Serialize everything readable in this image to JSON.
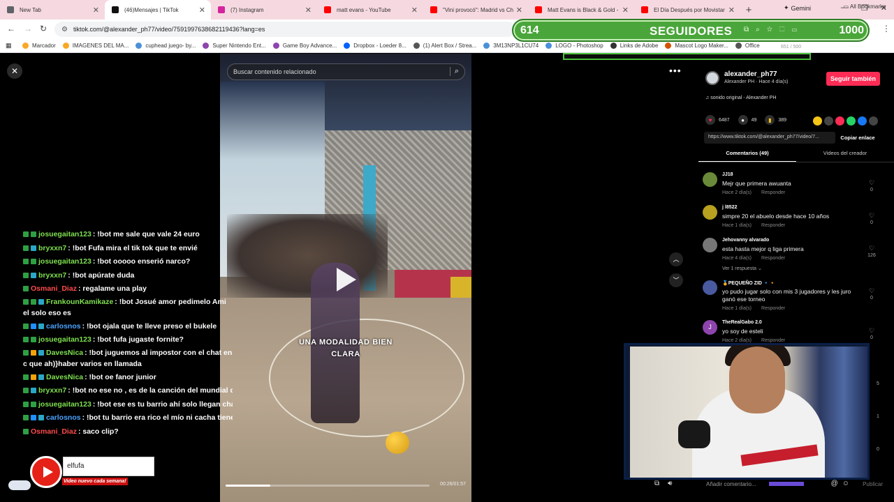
{
  "browser": {
    "tabs": [
      {
        "title": "New Tab",
        "color": "#5f6368"
      },
      {
        "title": "(46)Mensajes | TikTok",
        "color": "#111111"
      },
      {
        "title": "(7) Instagram",
        "color": "#d6249f"
      },
      {
        "title": "matt evans - YouTube",
        "color": "#ff0000"
      },
      {
        "title": "\"Vini provocó\": Madrid vs Ch",
        "color": "#ff0000"
      },
      {
        "title": "Matt Evans is Black & Gold -",
        "color": "#ff0000"
      },
      {
        "title": "El Día Después por Movistar",
        "color": "#ff0000"
      }
    ],
    "active_tab_index": 1,
    "new_tab": "+",
    "gemini_label": "Gemini",
    "url": "tiktok.com/@alexander_ph77/video/7591997638682119436?lang=es",
    "bookmarks": [
      {
        "label": "Marcador",
        "color": "#f9a825"
      },
      {
        "label": "IMAGENES DEL MA...",
        "color": "#f9a825"
      },
      {
        "label": "cuphead juego- by...",
        "color": "#4a90d9"
      },
      {
        "label": "Super Nintendo Ent...",
        "color": "#8e44ad"
      },
      {
        "label": "Game Boy Advance...",
        "color": "#8e44ad"
      },
      {
        "label": "Dropbox - Loeder 8...",
        "color": "#0061fe"
      },
      {
        "label": "(1) Alert Box / Strea...",
        "color": "#555555"
      },
      {
        "label": "3M13NP3L1CU74",
        "color": "#4a90d9"
      },
      {
        "label": "LOGO - Photoshop",
        "color": "#4a90d9"
      },
      {
        "label": "Links de Adobe",
        "color": "#333333"
      },
      {
        "label": "Mascot Logo Maker...",
        "color": "#d35400"
      },
      {
        "label": "Office",
        "color": "#555555"
      }
    ],
    "all_bookmarks": "All Bookmarks"
  },
  "followers": {
    "count": "614",
    "label": "SEGUIDORES",
    "goal": "1000",
    "small_text": "651 / 500",
    "progress": 0.614
  },
  "video": {
    "search_placeholder": "Buscar contenido relacionado",
    "caption": "UNA MODALIDAD BIEN CLARA",
    "time": "00:26/01:57",
    "progress": 0.22
  },
  "chat": [
    {
      "user": "josuegaitan123",
      "color": "#7ee04f",
      "badges": [
        "#2ea043",
        "#2ea043"
      ],
      "text": ": !bot me sale que vale 24 euro"
    },
    {
      "user": "bryxxn7",
      "color": "#7ee04f",
      "badges": [
        "#2ea043",
        "#2aa7c7"
      ],
      "text": ": !bot Fufa mira el tik tok que te envié"
    },
    {
      "user": "josuegaitan123",
      "color": "#7ee04f",
      "badges": [
        "#2ea043",
        "#2ea043"
      ],
      "text": ": !bot ooooo enserió narco?"
    },
    {
      "user": "bryxxn7",
      "color": "#7ee04f",
      "badges": [
        "#2ea043",
        "#2aa7c7"
      ],
      "text": ": !bot apúrate duda"
    },
    {
      "user": "Osmani_Diaz",
      "color": "#ff4b4b",
      "badges": [
        "#2ea043"
      ],
      "text": ": regalame una play"
    },
    {
      "user": "FrankounKamikaze",
      "color": "#7ee04f",
      "badges": [
        "#2ea043",
        "#2ea043",
        "#2aa7c7"
      ],
      "text": ": !bot Josué amor pedimelo Ami el solo eso es",
      "wrap": true
    },
    {
      "user": "carlosnos",
      "color": "#4aa3ff",
      "badges": [
        "#2ea043",
        "#1e90ff",
        "#2aa7c7"
      ],
      "text": ": !bot ojala que te lleve preso el bukele"
    },
    {
      "user": "josuegaitan123",
      "color": "#7ee04f",
      "badges": [
        "#2ea043",
        "#2ea043"
      ],
      "text": ": !bot fufa jugaste fornite?"
    },
    {
      "user": "DavesNica",
      "color": "#7ee04f",
      "badges": [
        "#2ea043",
        "#f0a30a",
        "#2aa7c7"
      ],
      "text": ": !bot juguemos al impostor con el chat en c que ah)}haber varios en llamada",
      "wrap": true
    },
    {
      "user": "DavesNica",
      "color": "#7ee04f",
      "badges": [
        "#2ea043",
        "#f0a30a",
        "#2aa7c7"
      ],
      "text": ": !bot oe fanor junior"
    },
    {
      "user": "bryxxn7",
      "color": "#7ee04f",
      "badges": [
        "#2ea043",
        "#2aa7c7"
      ],
      "text": ": !bot no ese no , es de la canción del mundial de"
    },
    {
      "user": "josuegaitan123",
      "color": "#7ee04f",
      "badges": [
        "#2ea043",
        "#2ea043"
      ],
      "text": ": !bot ese es tu barrio ahí solo llegan cha"
    },
    {
      "user": "carlosnos",
      "color": "#4aa3ff",
      "badges": [
        "#2ea043",
        "#1e90ff",
        "#2aa7c7"
      ],
      "text": ": !bot tu barrio era rico el mío ni cacha tiene"
    },
    {
      "user": "Osmani_Diaz",
      "color": "#ff4b4b",
      "badges": [
        "#2ea043"
      ],
      "text": ": saco clip?"
    }
  ],
  "stream_overlay": {
    "input_value": "elfufa",
    "subtitle": "Video nuevo cada semana!"
  },
  "creator": {
    "username": "alexander_ph77",
    "subline": "Alexander PH · Hace 4 día(s)",
    "follow_label": "Seguir también",
    "sound": "sonido original - Alexander PH",
    "likes": "6487",
    "comments": "49",
    "saves": "389",
    "link": "https://www.tiktok.com/@alexander_ph77/video/7...",
    "copy_label": "Copiar enlace",
    "share_colors": [
      "#f5c518",
      "#444444",
      "#fe2c55",
      "#25d366",
      "#1877f2",
      "#444444"
    ]
  },
  "tabs": {
    "comments": "Comentarios (49)",
    "creator_videos": "Videos del creador"
  },
  "comments": [
    {
      "user": "JJ18",
      "text": "Mejr que primera awuanta",
      "time": "Hace 2 día(s)",
      "reply": "Responder",
      "likes": "0",
      "avatar": "#6a8a3a"
    },
    {
      "user": "j l8522",
      "text": "simpre 20 el abuelo desde hace 10 años",
      "time": "Hace 1 día(s)",
      "reply": "Responder",
      "likes": "0",
      "avatar": "#b8a020"
    },
    {
      "user": "Jehovanny alvarado",
      "text": "esta hasta mejor q liga primera",
      "time": "Hace 4 día(s)",
      "reply": "Responder",
      "likes": "126",
      "avatar": "#777777",
      "replies": "Ver 1 respuesta ⌄"
    },
    {
      "user": "🏅PEQUEÑO ZID 🔹🔸",
      "text": "yo pudo jugar solo con mis 3 jugadores y les juro",
      "text2": "ganó ese torneo",
      "time": "Hace 1 día(s)",
      "reply": "Responder",
      "likes": "0",
      "avatar": "#4a5aa0"
    },
    {
      "user": "TheRealGabo 2.0",
      "text": "yo soy de esteli",
      "time": "Hace 2 día(s)",
      "reply": "Responder",
      "likes": "0",
      "avatar": "#8e44ad",
      "initial": "J"
    }
  ],
  "hidden_counts": [
    "5",
    "1",
    "0"
  ],
  "comment_bar": {
    "placeholder": "Añadir comentario...",
    "publish": "Publicar"
  }
}
